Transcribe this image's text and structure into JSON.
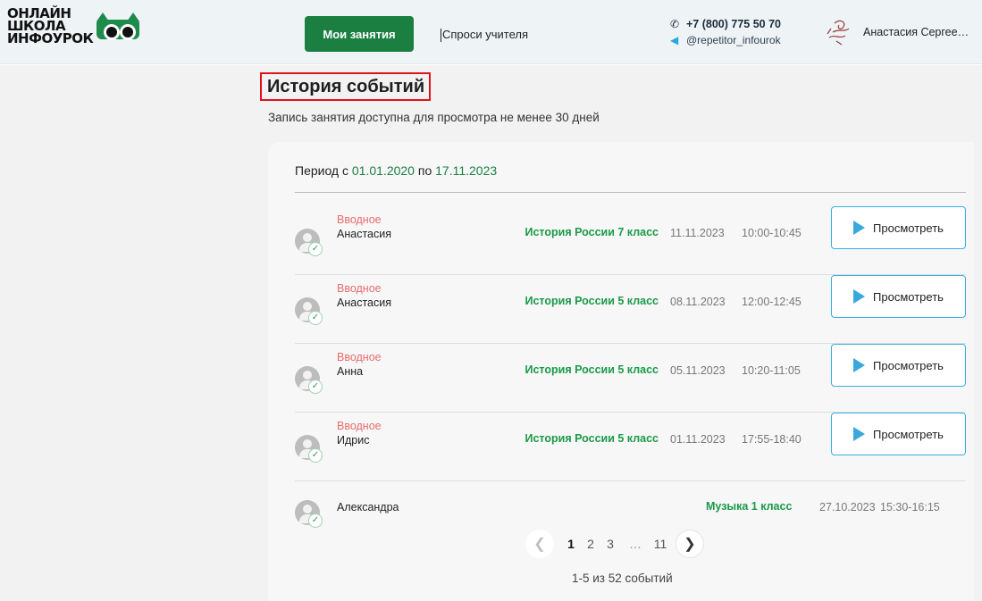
{
  "header": {
    "logo_lines": [
      "ОНЛАЙН",
      "ШКОЛА",
      "ИНФОУРОК"
    ],
    "my_lessons_label": "Мои занятия",
    "ask_teacher_label": "Спроси учителя",
    "phone": "+7 (800) 775 50 70",
    "telegram": "@repetitor_infourok",
    "user_name": "Анастасия Сергеевна"
  },
  "page": {
    "title": "История событий",
    "subtitle": "Запись занятия доступна для просмотра не менее 30 дней"
  },
  "period": {
    "from_label": "Период с",
    "from_date": "01.01.2020",
    "to_label": "по",
    "to_date": "17.11.2023"
  },
  "events": [
    {
      "type": "Вводное",
      "student": "Анастасия",
      "lesson": "История России 7 класс",
      "date": "11.11.2023",
      "time": "10:00-10:45",
      "action": "Просмотреть"
    },
    {
      "type": "Вводное",
      "student": "Анастасия",
      "lesson": "История России 5 класс",
      "date": "08.11.2023",
      "time": "12:00-12:45",
      "action": "Просмотреть"
    },
    {
      "type": "Вводное",
      "student": "Анна",
      "lesson": "История России 5 класс",
      "date": "05.11.2023",
      "time": "10:20-11:05",
      "action": "Просмотреть"
    },
    {
      "type": "Вводное",
      "student": "Идрис",
      "lesson": "История России 5 класс",
      "date": "01.11.2023",
      "time": "17:55-18:40",
      "action": "Просмотреть"
    },
    {
      "type": "",
      "student": "Александра",
      "lesson": "Музыка 1 класс",
      "date": "27.10.2023",
      "time": "15:30-16:15",
      "action": ""
    }
  ],
  "pagination": {
    "pages": [
      "1",
      "2",
      "3"
    ],
    "ellipsis": "…",
    "last_page": "11",
    "current": "1",
    "summary": "1-5 из 52 событий"
  },
  "colors": {
    "brand_green": "#1a7f41",
    "lesson_green": "#1a9a48",
    "intro_red": "#e86c6c",
    "button_border_blue": "#39aee0",
    "highlight_red": "#e0131a"
  }
}
